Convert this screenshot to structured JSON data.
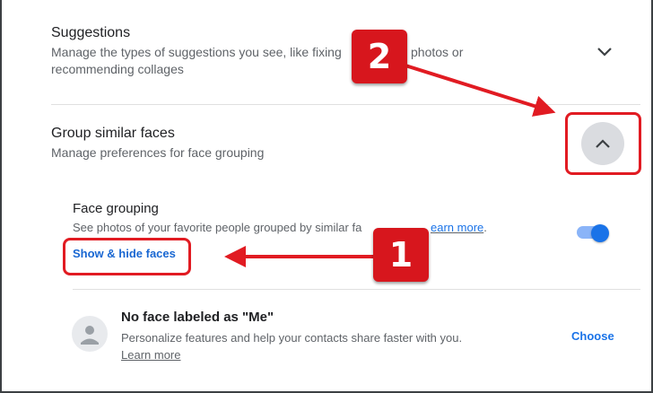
{
  "suggestions": {
    "title": "Suggestions",
    "desc_line1": "Manage the types of suggestions you see, like fixing",
    "desc_line1_end": "photos or",
    "desc_line2": "recommending collages"
  },
  "group_faces": {
    "title": "Group similar faces",
    "desc": "Manage preferences for face grouping"
  },
  "face_grouping": {
    "title": "Face grouping",
    "desc": "See photos of your favorite people grouped by similar fa",
    "learn_more": "earn more",
    "desc_end": ".",
    "show_hide": "Show & hide faces",
    "toggle_on": true
  },
  "me_label": {
    "title": "No face labeled as \"Me\"",
    "desc": "Personalize features and help your contacts share faster with you.",
    "learn_more": "Learn more",
    "choose": "Choose"
  },
  "annotations": {
    "badge1": "1",
    "badge2": "2",
    "color": "#e11b22"
  }
}
